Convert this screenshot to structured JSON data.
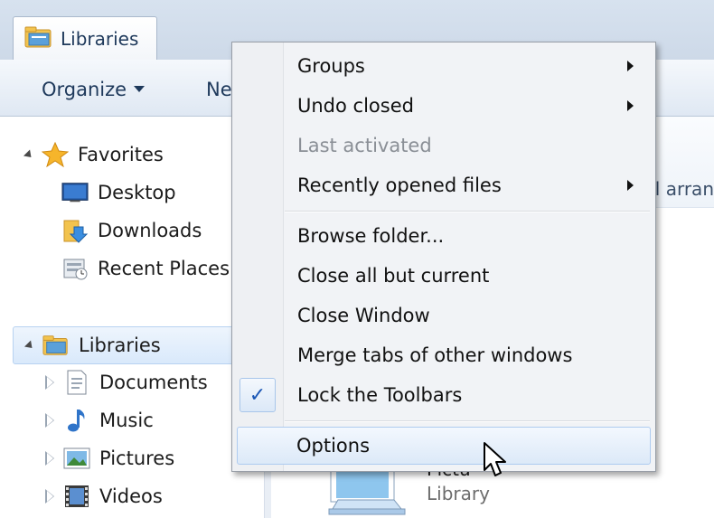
{
  "tabs": [
    {
      "label": "Libraries"
    }
  ],
  "toolbar": {
    "organize_label": "Organize",
    "new_label": "Ne"
  },
  "nav": {
    "favorites": {
      "label": "Favorites"
    },
    "favorite_items": [
      {
        "label": "Desktop"
      },
      {
        "label": "Downloads"
      },
      {
        "label": "Recent Places"
      }
    ],
    "libraries": {
      "label": "Libraries"
    },
    "library_items": [
      {
        "label": "Documents"
      },
      {
        "label": "Music"
      },
      {
        "label": "Pictures"
      },
      {
        "label": "Videos"
      }
    ]
  },
  "content": {
    "arrange_text": "l arran",
    "pictures_name": "Pictu",
    "pictures_sub": "Library"
  },
  "menu": {
    "items": [
      {
        "label": "Groups",
        "submenu": true
      },
      {
        "label": "Undo closed",
        "submenu": true
      },
      {
        "label": "Last activated",
        "disabled": true
      },
      {
        "label": "Recently opened files",
        "submenu": true
      },
      {
        "label": "Browse folder..."
      },
      {
        "label": "Close all but current"
      },
      {
        "label": "Close Window"
      },
      {
        "label": "Merge tabs of other windows"
      },
      {
        "label": "Lock the Toolbars",
        "checked": true
      },
      {
        "label": "Options",
        "highlighted": true
      }
    ],
    "check_glyph": "✓"
  },
  "colors": {
    "accent": "#1a56b5",
    "menu_bg": "#f1f3f6",
    "selection": "#d9e9fb"
  }
}
